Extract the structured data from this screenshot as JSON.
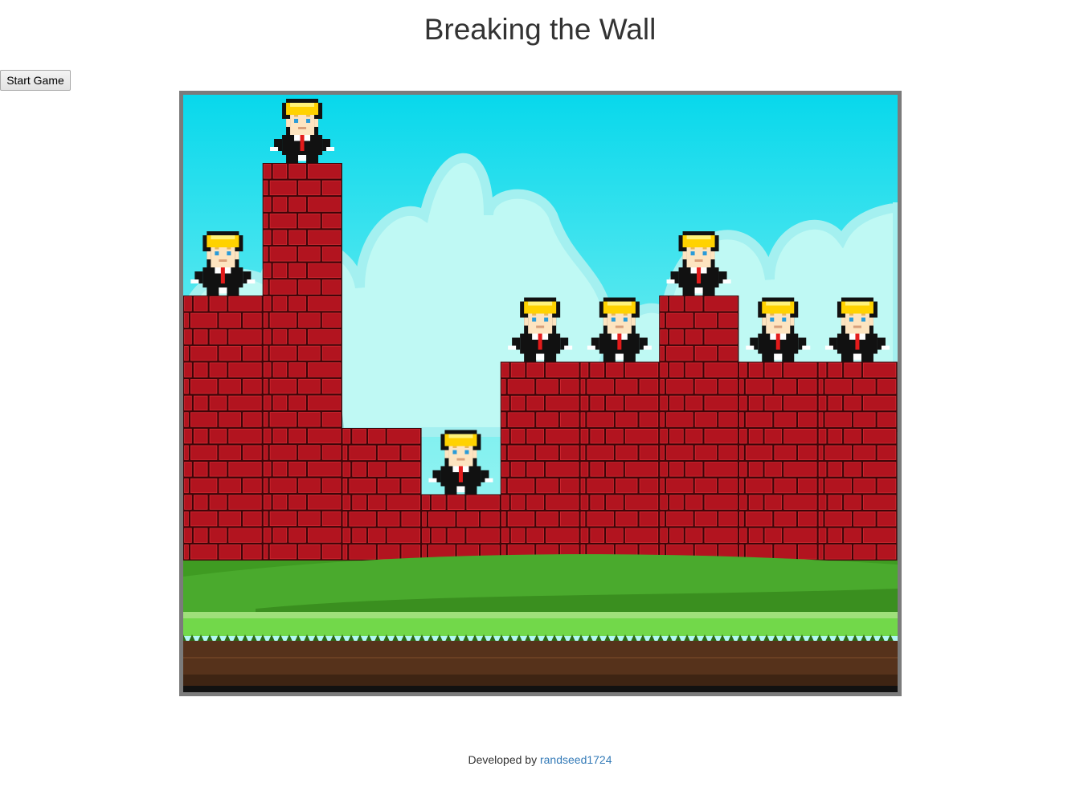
{
  "page": {
    "title": "Breaking the Wall"
  },
  "controls": {
    "start_label": "Start Game"
  },
  "game": {
    "sky_top_color": "#08d8ec",
    "sky_bottom_color": "#bff9f4",
    "brick_color": "#b2141f",
    "mortar_color": "#3e0508",
    "grass_color": "#3f9b22",
    "soil_color": "#56321b",
    "character_icon": "blonde-man-in-black-suit-red-tie",
    "wall_columns": [
      4,
      6,
      2,
      1,
      3,
      3,
      4,
      3,
      3
    ],
    "characters_on_columns": [
      1,
      2,
      4,
      5,
      6,
      7,
      8,
      9
    ]
  },
  "footer": {
    "prefix": "Developed by",
    "author": "randseed1724"
  }
}
